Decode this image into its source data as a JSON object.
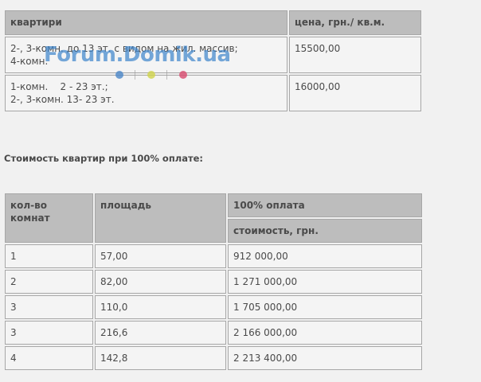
{
  "table1": {
    "headers": [
      "квартири",
      "цена, грн./ кв.м."
    ],
    "rows": [
      {
        "desc_lines": [
          "2-, 3-комн. до 13 эт. с видом на жил. массив;",
          "4-комн."
        ],
        "price": "15500,00"
      },
      {
        "desc_lines": [
          "1-комн.    2 - 23 эт.;",
          "2-, 3-комн. 13- 23 эт."
        ],
        "price": "16000,00"
      }
    ]
  },
  "heading": "Стоимость квартир при 100% оплате:",
  "table2": {
    "headers": {
      "rooms": "кол-во комнат",
      "area": "площадь",
      "full_payment": "100% оплата",
      "cost": "стоимость, грн."
    },
    "rows": [
      {
        "rooms": "1",
        "area": "57,00",
        "cost": "912 000,00"
      },
      {
        "rooms": "2",
        "area": "82,00",
        "cost": "1 271 000,00"
      },
      {
        "rooms": "3",
        "area": "110,0",
        "cost": "1 705 000,00"
      },
      {
        "rooms": "3",
        "area": "216,6",
        "cost": "2 166 000,00"
      },
      {
        "rooms": "4",
        "area": "142,8",
        "cost": "2 213 400,00"
      }
    ]
  },
  "watermark": {
    "text": "Forum.Domik.ua",
    "colors": [
      "#4a86c8",
      "#cfd34a",
      "#d84a6e"
    ]
  }
}
